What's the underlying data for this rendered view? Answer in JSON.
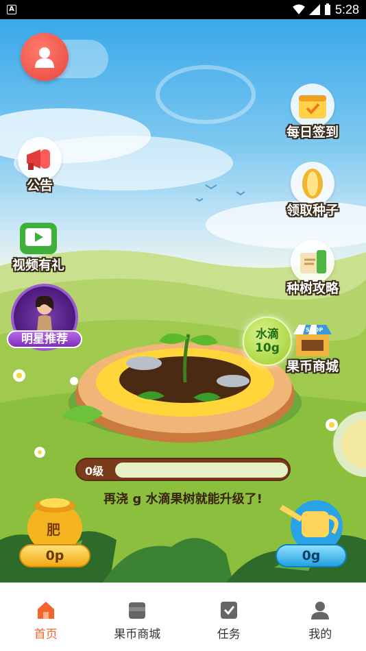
{
  "status_bar": {
    "time": "5:28",
    "badge": "A"
  },
  "side_menu": {
    "announcement": "公告",
    "video_gift": "视频有礼",
    "star_recommend": "明星推荐",
    "daily_checkin": "每日签到",
    "get_seeds": "领取种子",
    "planting_guide": "种树攻略",
    "fruit_coin_mall": "果币商城"
  },
  "water_badge": {
    "label": "水滴",
    "amount": "10g"
  },
  "mall_icon_text": "SHOP",
  "progress": {
    "level": "0级",
    "fraction": 0.0
  },
  "hint": "再浇 g 水滴果树就能升级了!",
  "fertilizer": {
    "label": "肥",
    "amount": "0p"
  },
  "water": {
    "amount": "0g"
  },
  "nav": {
    "tabs": [
      {
        "label": "首页",
        "icon": "home-icon",
        "active": true
      },
      {
        "label": "果币商城",
        "icon": "shop-icon",
        "active": false
      },
      {
        "label": "任务",
        "icon": "task-icon",
        "active": false
      },
      {
        "label": "我的",
        "icon": "user-icon",
        "active": false
      }
    ]
  },
  "colors": {
    "active_tab": "#f2652c",
    "avatar": "#e8473d",
    "progress_bg": "#7a3b1a"
  }
}
